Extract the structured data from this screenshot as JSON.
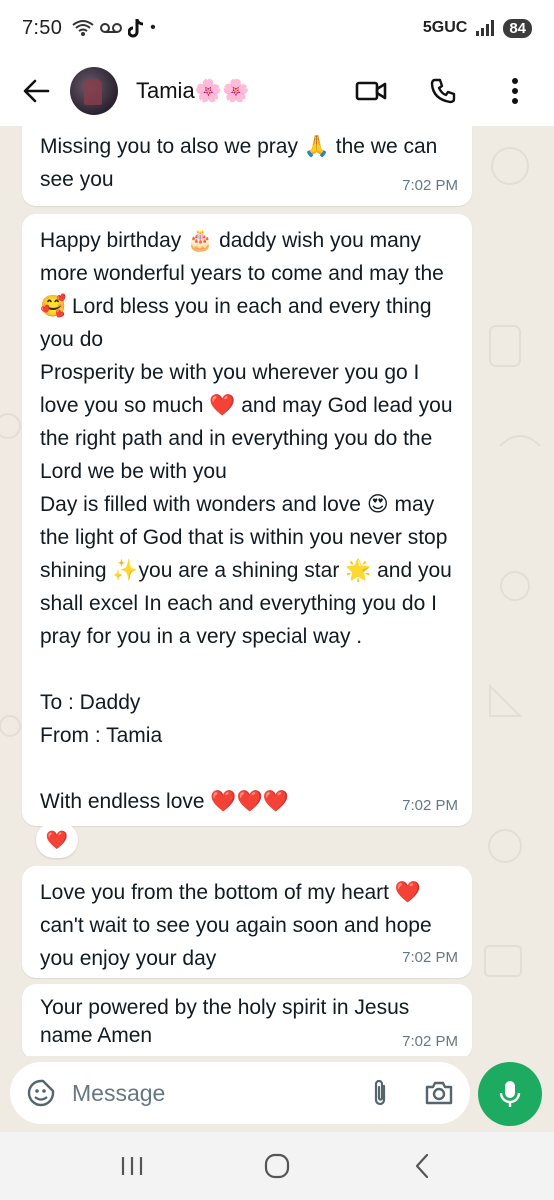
{
  "status_bar": {
    "time": "7:50",
    "network": "5GUC",
    "battery": "84"
  },
  "header": {
    "contact_name": "Tamia🌸🌸",
    "icons": [
      "back-arrow-icon",
      "video-call-icon",
      "phone-icon",
      "more-options-icon"
    ]
  },
  "messages": [
    {
      "text": "Missing you to also we pray 🙏 the we can see you",
      "time": "7:02 PM"
    },
    {
      "text": "Happy birthday 🎂 daddy wish you many more wonderful years to come and may the🥰 Lord bless you in each and every thing you do\nProsperity be with you wherever you go I love you so much ❤️ and may God lead you the right path and in everything you do the Lord we be with you\nDay is filled with wonders and love 😍 may the light of God that is within you never stop shining ✨you are a shining star 🌟 and you shall excel In each and everything you do I pray for you in a very special way .\n\nTo : Daddy\nFrom : Tamia\n\nWith endless love ❤️❤️❤️",
      "time": "7:02 PM",
      "reaction": "❤️"
    },
    {
      "text": "Love you from the bottom of my heart ❤️ can't wait to see you again soon and hope you enjoy your day",
      "time": "7:02 PM"
    },
    {
      "text": "Your powered by the holy spirit in Jesus name Amen",
      "time": "7:02 PM"
    }
  ],
  "composer": {
    "placeholder": "Message"
  },
  "colors": {
    "chat_background": "#efeae2",
    "bubble": "#ffffff",
    "mic_button": "#1daa61",
    "timestamp": "#667781"
  }
}
